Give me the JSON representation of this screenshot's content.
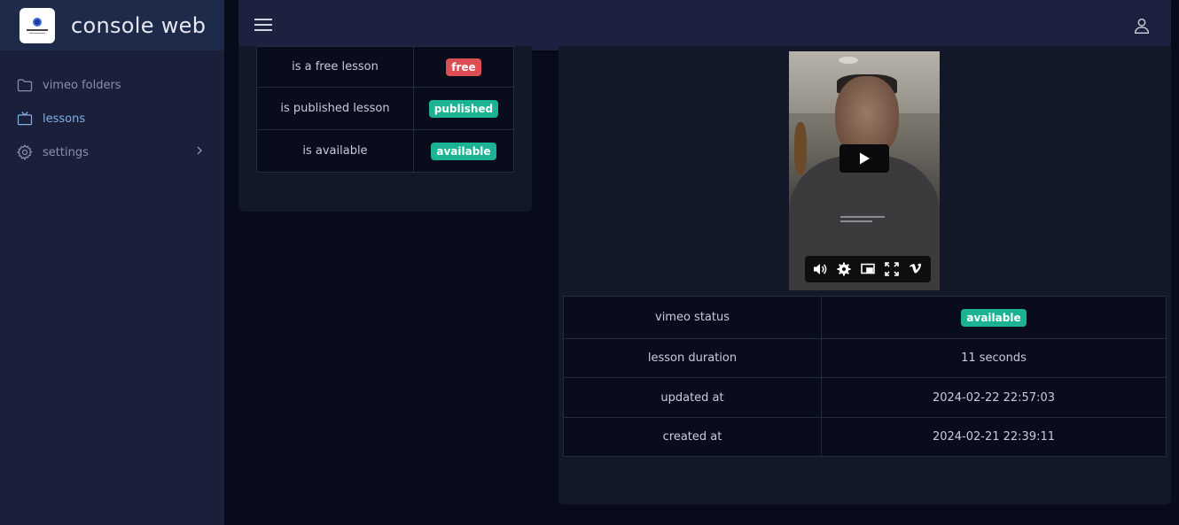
{
  "app": {
    "title": "console web"
  },
  "sidebar": {
    "items": [
      {
        "label": "vimeo folders",
        "icon": "folder-icon"
      },
      {
        "label": "lessons",
        "icon": "tv-icon",
        "active": true
      },
      {
        "label": "settings",
        "icon": "gear-icon",
        "has_submenu": true
      }
    ]
  },
  "topbar": {
    "menu_icon": "hamburger-menu-icon",
    "user_icon": "user-icon"
  },
  "lesson_flags": [
    {
      "label": "is a free lesson",
      "badge": "free",
      "badge_color": "#dc4d54"
    },
    {
      "label": "is published lesson",
      "badge": "published",
      "badge_color": "#1cb394"
    },
    {
      "label": "is available",
      "badge": "available",
      "badge_color": "#1cb394"
    }
  ],
  "video": {
    "controls": [
      "volume-icon",
      "settings-icon",
      "pip-icon",
      "fullscreen-icon",
      "vimeo-logo-icon"
    ]
  },
  "lesson_info": [
    {
      "label": "vimeo status",
      "value": "available",
      "is_badge": true
    },
    {
      "label": "lesson duration",
      "value": "11 seconds"
    },
    {
      "label": "updated at",
      "value": "2024-02-22 22:57:03"
    },
    {
      "label": "created at",
      "value": "2024-02-21 22:39:11"
    }
  ],
  "colors": {
    "accent": "#7fb0e8",
    "success": "#1cb394",
    "danger": "#dc4d54",
    "background": "#080b1a",
    "sidebar": "#1a1f3a"
  }
}
